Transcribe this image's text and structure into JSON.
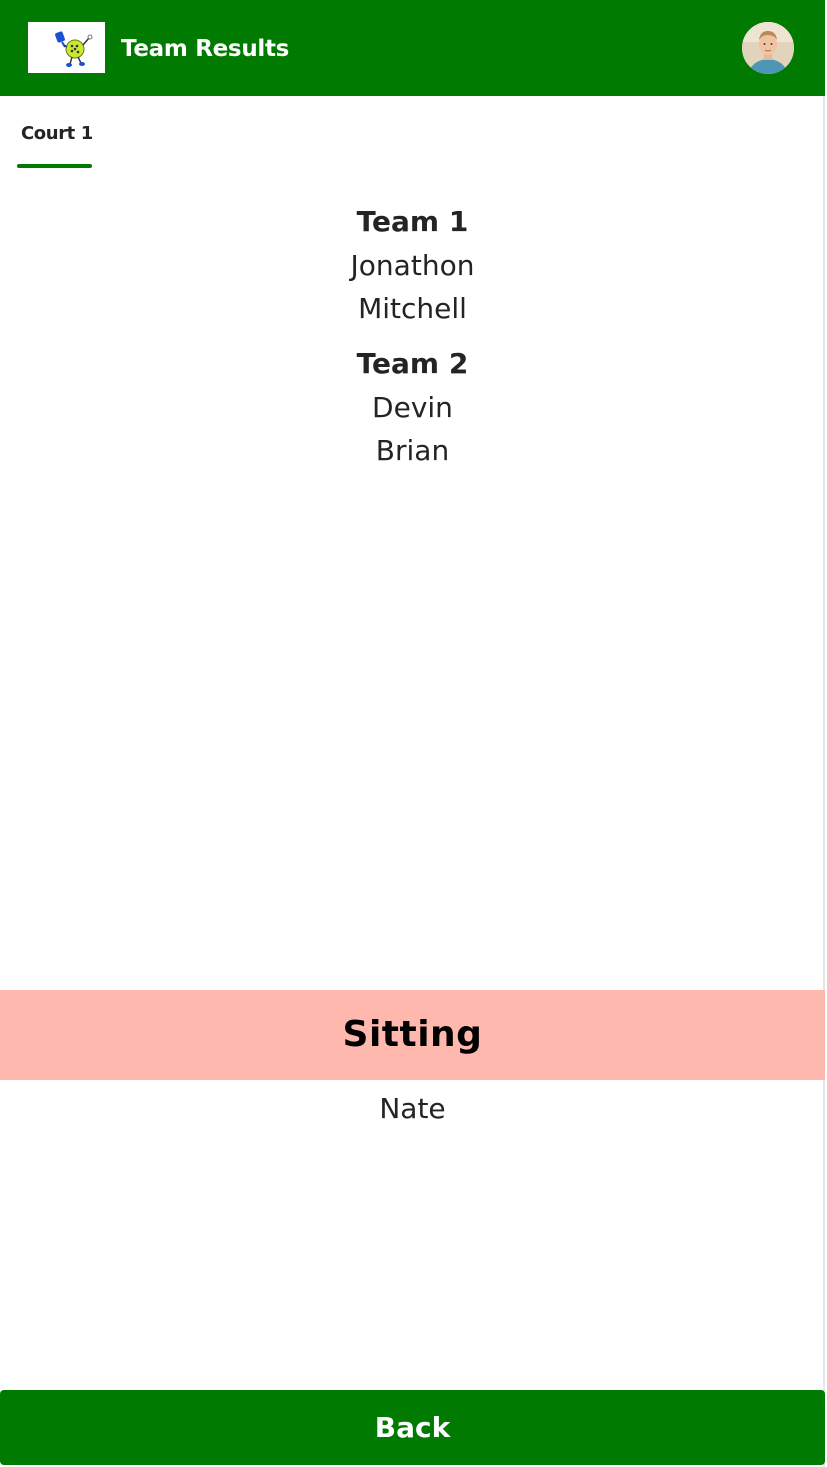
{
  "header": {
    "title": "Team Results",
    "logo_icon": "pickleball-player-logo-icon",
    "avatar_icon": "user-avatar-icon",
    "background_color": "#007a00"
  },
  "tabs": [
    {
      "label": "Court 1",
      "selected": true
    }
  ],
  "teams": [
    {
      "name": "Team 1",
      "players": [
        "Jonathon",
        "Mitchell"
      ]
    },
    {
      "name": "Team 2",
      "players": [
        "Devin",
        "Brian"
      ]
    }
  ],
  "sitting": {
    "title": "Sitting",
    "banner_color": "#ffb8ae",
    "players": [
      "Nate"
    ]
  },
  "footer": {
    "back_label": "Back",
    "button_color": "#007a00"
  }
}
